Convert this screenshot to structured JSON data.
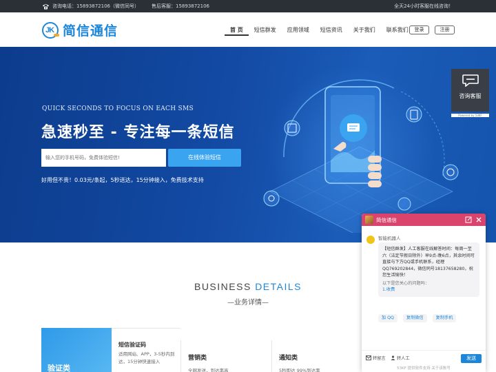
{
  "topbar": {
    "phone": "咨询电话：15893872106（微信同号）",
    "after_sales": "售后客服：15893872106",
    "service_hours": "全天24小时客服在线咨询！"
  },
  "header": {
    "logo_mark": "JK",
    "logo_text": "简信通信",
    "nav": [
      "首 页",
      "短信群发",
      "应用领域",
      "短信资讯",
      "关于我们",
      "联系我们"
    ],
    "login": "登录",
    "register": "注册"
  },
  "hero": {
    "subtitle": "QUICK SECONDS TO FOCUS ON EACH SMS",
    "title": "急速秒至 - 专注每一条短信",
    "input_placeholder": "输入您的手机号码，免费体验短信!",
    "button": "在线体验短信",
    "note": "好用但不贵！0.03元/条起，5秒送达，15分钟接入，免费技术支持"
  },
  "service_badge": {
    "label": "咨询客服",
    "powered": "Powered by 53KF"
  },
  "business": {
    "title_a": "BUSINESS ",
    "title_b": "DETAILS",
    "subtitle": "—业务详情—",
    "featured": {
      "category": "验证类",
      "title": "短信验证码",
      "desc": "适用网站、APP，3-5秒内到达，15分钟快速接入"
    },
    "cards": [
      {
        "title": "营销类",
        "desc": "全网发送，到达率高"
      },
      {
        "title": "通知类",
        "desc": "5秒即达 99%到达率"
      }
    ]
  },
  "chat": {
    "title": "简信通信",
    "bot_name": "智能机器人",
    "message": "【短信群发】人工客服在线解答时间：每周一至六（法定节假日除外）早9点-晚6点，其余时间可直接与下方QQ或手机联系，经理QQ769202844，微信同号18137658280，祝您生活愉快！",
    "question_hint": "以下是您关心的问题吗：",
    "question_link": "1.收费",
    "chips": [
      "加 QQ",
      "复制微信",
      "复制手机"
    ],
    "tool_msg": "转留言",
    "tool_human": "转人工",
    "send": "发送",
    "footer": "53KF 提供软件支持  关于该账号"
  },
  "colors": {
    "brand_blue": "#1e86d8",
    "hero_blue": "#134aa4",
    "chat_header": "#d9436c",
    "topbar_bg": "#2b2f36"
  }
}
